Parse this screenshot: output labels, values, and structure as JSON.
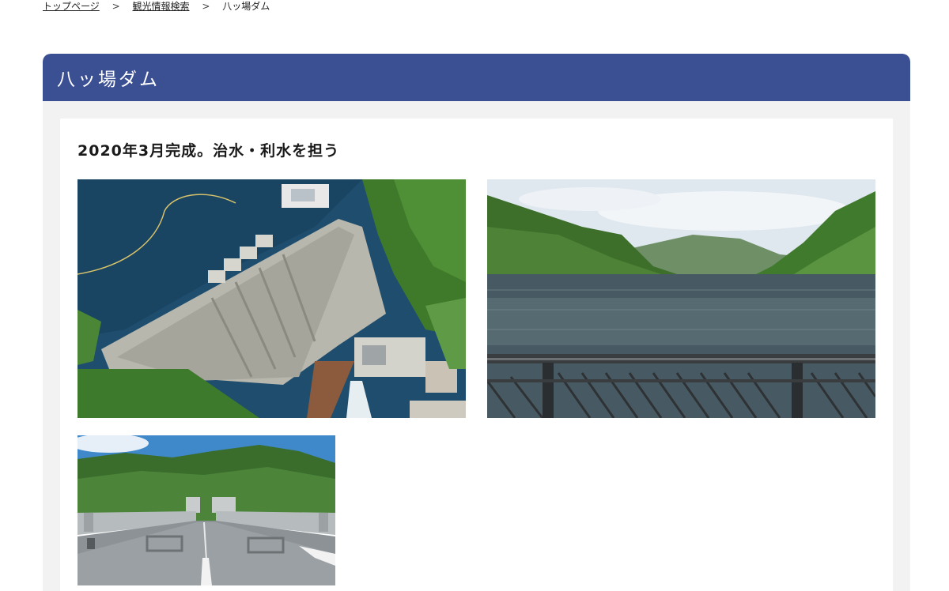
{
  "breadcrumb": {
    "items": [
      {
        "label": "トップページ",
        "link": true
      },
      {
        "label": "観光情報検索",
        "link": true
      },
      {
        "label": "八ッ場ダム",
        "link": false
      }
    ],
    "separator": ">"
  },
  "page": {
    "title": "八ッ場ダム",
    "heading": "2020年3月完成。治水・利水を担う"
  },
  "colors": {
    "header_bg": "#3b4f93",
    "panel_bg": "#f2f2f2"
  },
  "photos": [
    {
      "subject": "dam-aerial"
    },
    {
      "subject": "reservoir-lake-view"
    },
    {
      "subject": "dam-crest-road"
    }
  ]
}
